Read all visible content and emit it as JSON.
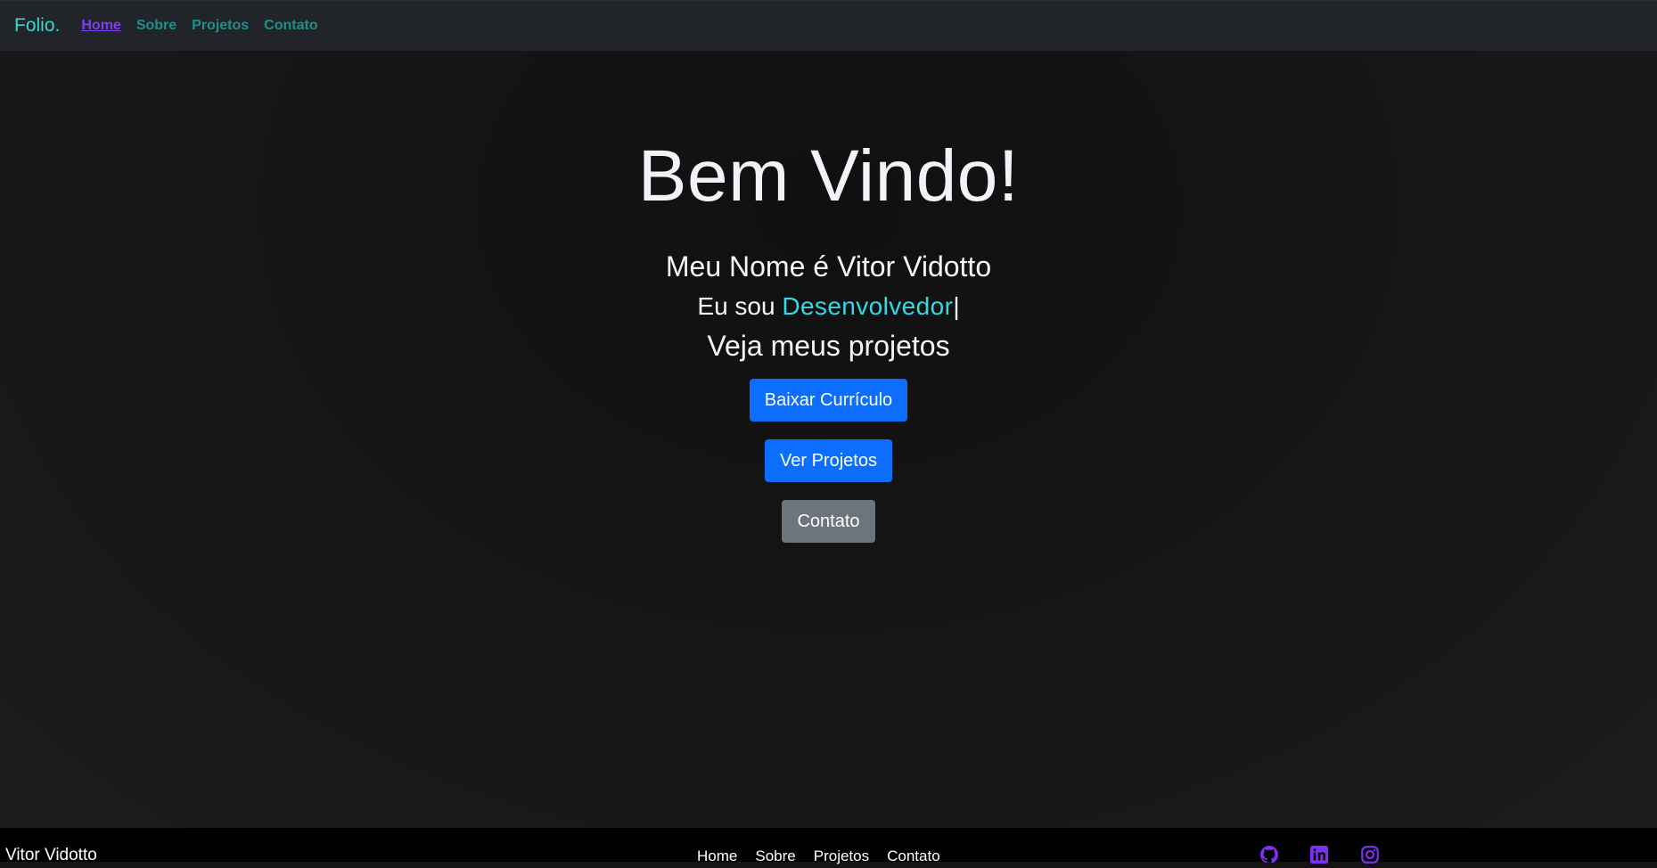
{
  "navbar": {
    "brand": "Folio.",
    "links": [
      "Home",
      "Sobre",
      "Projetos",
      "Contato"
    ],
    "active": "Home"
  },
  "hero": {
    "title": "Bem Vindo!",
    "name_line": "Meu Nome é Vitor Vidotto",
    "role_prefix": "Eu sou ",
    "role_word": "Desenvolvedor",
    "cursor": "|",
    "projects_line": "Veja meus projetos",
    "buttons": {
      "resume": "Baixar Currículo",
      "projects": "Ver Projetos",
      "contact": "Contato"
    }
  },
  "footer": {
    "name": "Vitor Vidotto",
    "links": [
      "Home",
      "Sobre",
      "Projetos",
      "Contato"
    ],
    "social_icons": [
      "github-icon",
      "linkedin-icon",
      "instagram-icon"
    ]
  },
  "colors": {
    "brand": "#3fd6d0",
    "nav_link": "#1f8f8c",
    "nav_active": "#7b3ff0",
    "role_word": "#34d9e3",
    "btn_primary": "#0d6efd",
    "btn_secondary": "#6c757d",
    "social_icon": "#7b2ff2"
  }
}
